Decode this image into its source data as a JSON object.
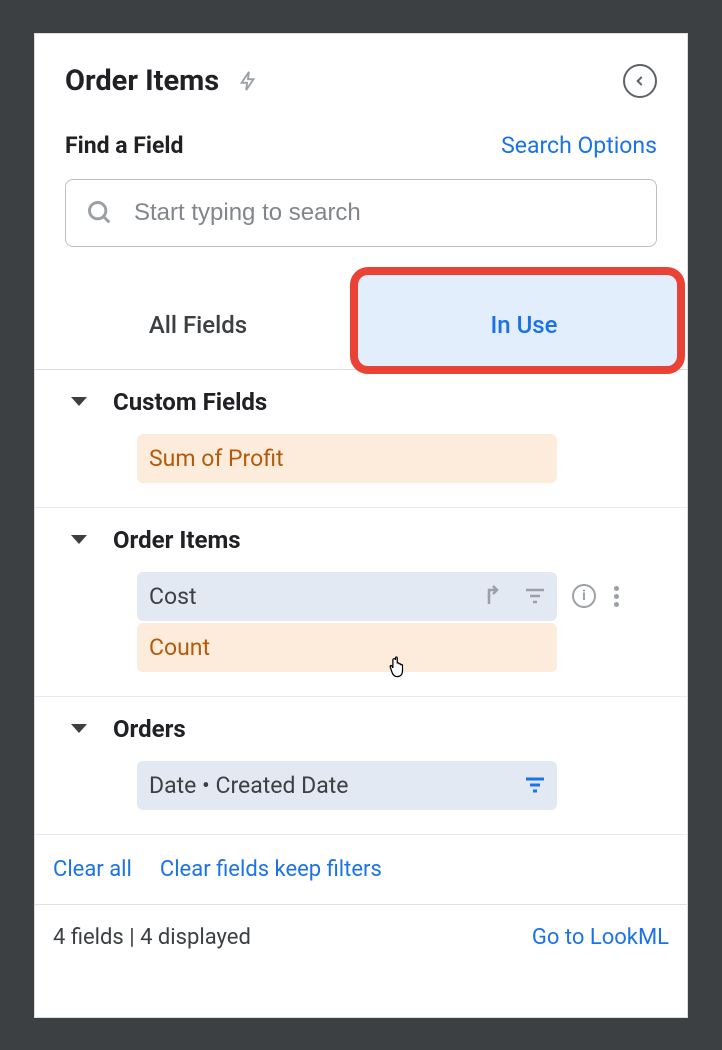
{
  "header": {
    "title": "Order Items"
  },
  "search": {
    "label": "Find a Field",
    "options_label": "Search Options",
    "placeholder": "Start typing to search"
  },
  "tabs": {
    "all_fields": "All Fields",
    "in_use": "In Use"
  },
  "groups": [
    {
      "title": "Custom Fields",
      "fields": [
        {
          "label": "Sum of Profit",
          "type": "measure"
        }
      ]
    },
    {
      "title": "Order Items",
      "fields": [
        {
          "label": "Cost",
          "type": "dimension",
          "hover": true
        },
        {
          "label": "Count",
          "type": "measure"
        }
      ]
    },
    {
      "title": "Orders",
      "fields": [
        {
          "label": "Date • Created Date",
          "type": "dimension",
          "filter": true
        }
      ]
    }
  ],
  "links": {
    "clear_all": "Clear all",
    "clear_filters": "Clear fields keep filters"
  },
  "footer": {
    "status": "4 fields | 4 displayed",
    "go_to_lookml": "Go to LookML"
  }
}
